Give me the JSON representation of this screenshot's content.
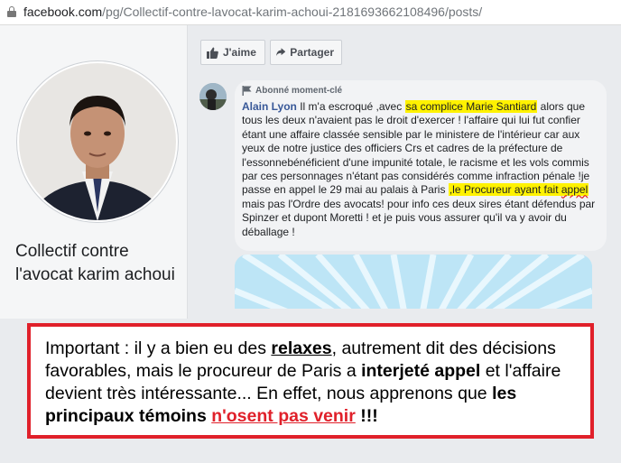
{
  "browser": {
    "url_domain": "facebook.com",
    "url_path": "/pg/Collectif-contre-lavocat-karim-achoui-2181693662108496/posts/"
  },
  "page": {
    "name": "Collectif contre l'avocat karim achoui"
  },
  "actions": {
    "like_label": "J'aime",
    "share_label": "Partager"
  },
  "comment": {
    "badge": "Abonné moment-clé",
    "author": "Alain Lyon",
    "t1": " Il m'a escroqué ,avec ",
    "hl1": "sa complice Marie Santiard",
    "t2": " alors que tous les deux n'avaient pas le droit d'exercer ! l'affaire qui lui fut confier étant une affaire classée sensible par le ministere de l'intérieur car aux yeux de notre justice des officiers Crs et cadres de la préfecture de l'essonnebénéficient d'une impunité totale, le racisme et les vols commis par ces personnages n'étant pas considérés comme infraction pénale !je passe en appel le 29 mai au palais à Paris ",
    "hl2a": ",le Procureur ayant fait ",
    "hl2b": "appel",
    "t3": " mais pas l'Ordre des avocats! pour info ces deux sires étant défendus par Spinzer et dupont Moretti ! et je puis vous assurer qu'il va y avoir du déballage !"
  },
  "callout": {
    "p1": "Important : il y a bien eu des ",
    "b1": "relaxes",
    "p2": ", autrement dit des décisions favorables, mais le procureur de Paris a ",
    "b2": "interjeté appel",
    "p3": " et l'affaire devient très intéressante... En effet, nous apprenons que ",
    "b3": "les principaux témoins",
    "p4": " ",
    "b4": "n'osent pas venir",
    "p5": " ",
    "b5": "!!!"
  },
  "colors": {
    "highlight": "#fff200",
    "callout_border": "#e0202a",
    "author_link": "#385898"
  },
  "icons": [
    "lock-icon",
    "thumbs-up-icon",
    "share-arrow-icon",
    "flag-icon"
  ]
}
